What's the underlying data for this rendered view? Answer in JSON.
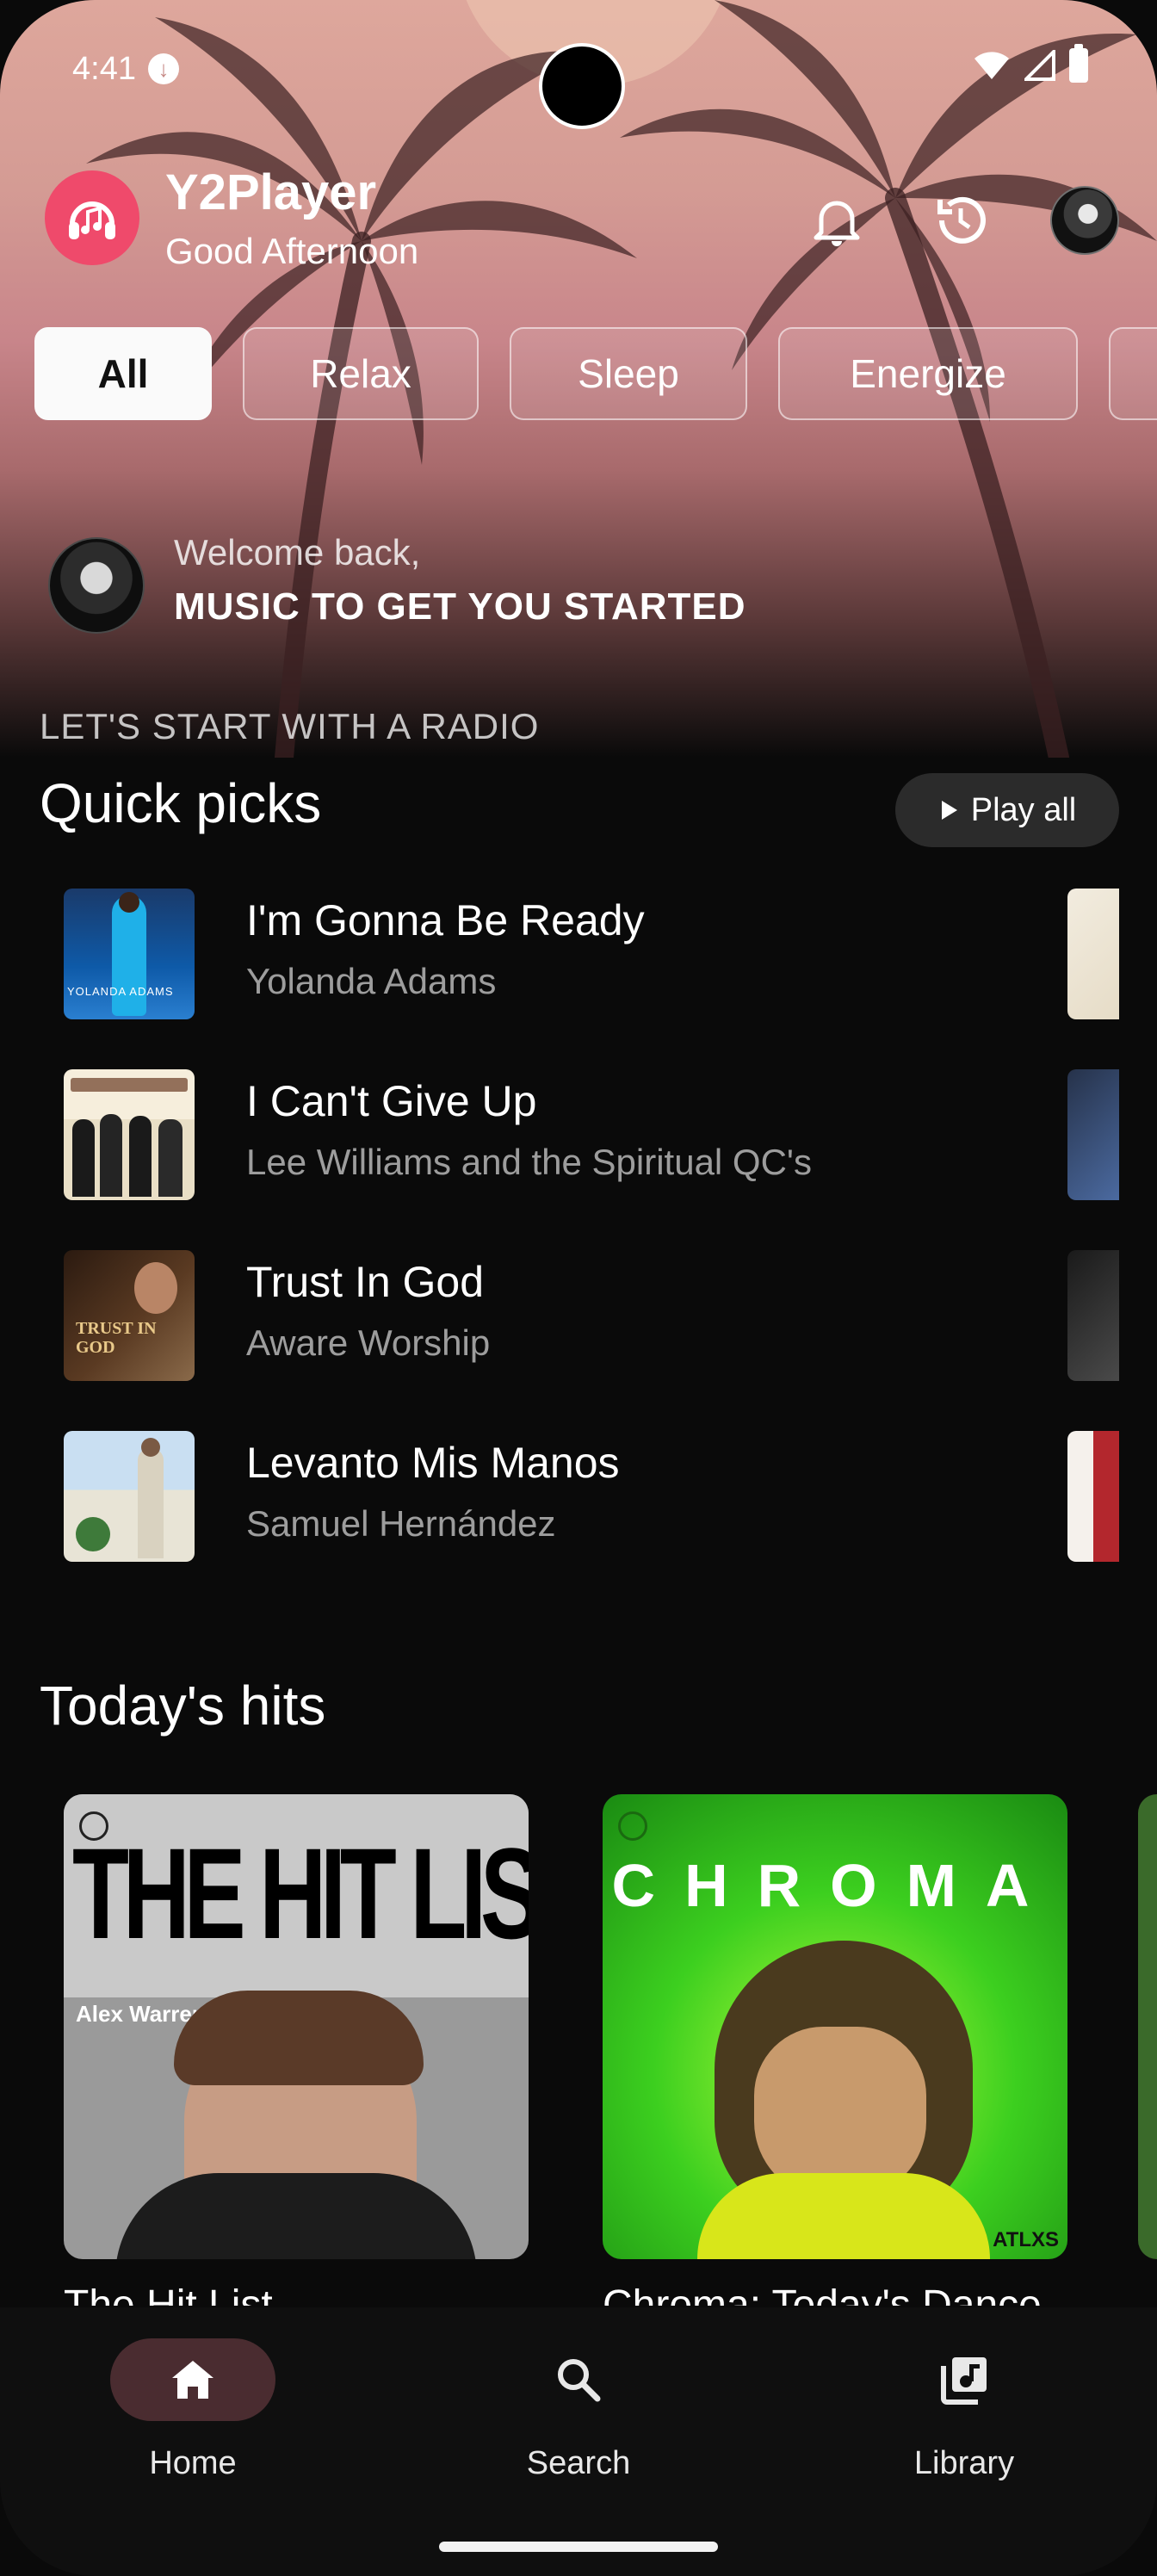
{
  "status_bar": {
    "time": "4:41",
    "icons": [
      "download-icon",
      "wifi-icon",
      "cellular-icon",
      "battery-icon"
    ]
  },
  "header": {
    "app_name": "Y2Player",
    "greeting": "Good Afternoon",
    "icons": [
      "notifications-icon",
      "history-icon",
      "profile-avatar"
    ]
  },
  "chips": [
    {
      "label": "All",
      "selected": true
    },
    {
      "label": "Relax",
      "selected": false
    },
    {
      "label": "Sleep",
      "selected": false
    },
    {
      "label": "Energize",
      "selected": false
    }
  ],
  "welcome": {
    "subtitle": "Welcome back,",
    "title": "MUSIC TO GET YOU STARTED"
  },
  "radio_label": "LET'S START WITH A RADIO",
  "quick_picks": {
    "title": "Quick picks",
    "play_all_label": "Play all",
    "tracks": [
      {
        "title": "I'm Gonna Be Ready",
        "artist": "Yolanda Adams",
        "art_text": "YOLANDA ADAMS"
      },
      {
        "title": "I Can't Give Up",
        "artist": "Lee Williams and the Spiritual QC's",
        "art_text": ""
      },
      {
        "title": "Trust In God",
        "artist": "Aware Worship",
        "art_text": "TRUST IN GOD"
      },
      {
        "title": "Levanto Mis Manos",
        "artist": "Samuel Hernández",
        "art_text": ""
      }
    ]
  },
  "todays_hits": {
    "title": "Today's hits",
    "playlists": [
      {
        "title": "The Hit List",
        "art_headline": "THE HIT LIST",
        "art_caption": "Alex Warren"
      },
      {
        "title": "Chroma: Today's Dance",
        "art_headline": "CHROMA",
        "art_caption": "ATLXS"
      }
    ]
  },
  "colors": {
    "accent": "#ef4a6b",
    "nav_active": "#4a2c30",
    "background": "#0a0a0a"
  },
  "bottom_nav": [
    {
      "label": "Home",
      "icon": "home-icon",
      "active": true
    },
    {
      "label": "Search",
      "icon": "search-icon",
      "active": false
    },
    {
      "label": "Library",
      "icon": "library-icon",
      "active": false
    }
  ]
}
